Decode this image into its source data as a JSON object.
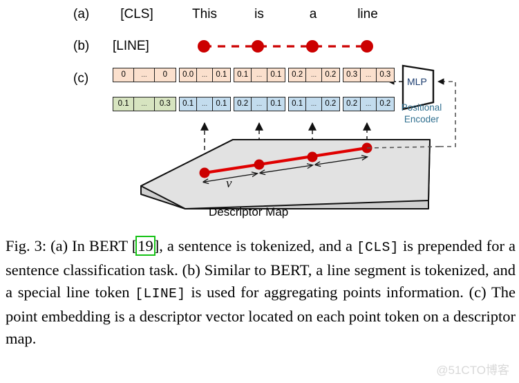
{
  "figure": {
    "rows": {
      "a": {
        "label": "(a)",
        "special_token": "[CLS]",
        "words": [
          "This",
          "is",
          "a",
          "line"
        ]
      },
      "b": {
        "label": "(b)",
        "special_token": "[LINE]",
        "point_count": 4
      },
      "c": {
        "label": "(c)"
      }
    },
    "embeddings": {
      "special": {
        "top": [
          "0",
          "...",
          "0"
        ],
        "bottom": [
          "0.1",
          "...",
          "0.3"
        ]
      },
      "tokens": [
        {
          "top": [
            "0.0",
            "...",
            "0.1"
          ],
          "bottom": [
            "0.1",
            "...",
            "0.1"
          ]
        },
        {
          "top": [
            "0.1",
            "...",
            "0.1"
          ],
          "bottom": [
            "0.2",
            "...",
            "0.1"
          ]
        },
        {
          "top": [
            "0.2",
            "...",
            "0.2"
          ],
          "bottom": [
            "0.1",
            "...",
            "0.2"
          ]
        },
        {
          "top": [
            "0.3",
            "...",
            "0.3"
          ],
          "bottom": [
            "0.2",
            "...",
            "0.2"
          ]
        }
      ]
    },
    "mlp_label": "MLP",
    "positional_encoder_label": "Positional\nEncoder",
    "positional_encoder_line1": "Positional",
    "positional_encoder_line2": "Encoder",
    "descriptor_map_label": "Descriptor Map",
    "vector_symbol": "v",
    "colors": {
      "point_red": "#cc0000",
      "line_red": "#e00000",
      "plane_fill": "#e2e2e2",
      "peach": "#fbe0cd",
      "green": "#d7e4c0",
      "blue": "#c3dcee",
      "mlp_text": "#1a3b6e",
      "positional_text": "#2f6f8f",
      "citation_highlight": "#16c216"
    }
  },
  "caption": {
    "prefix": "Fig. 3: (a) In BERT [",
    "citation": "19",
    "part1": "], a sentence is tokenized, and a ",
    "cls_token": "[CLS]",
    "part2": " is prepended for a sentence classification task. (b) Similar to BERT, a line segment is tokenized, and a special line token ",
    "line_token": "[LINE]",
    "part3": " is used for aggregating points information. (c) The point embedding is a descriptor vector located on each point token on a descriptor map."
  },
  "watermark": {
    "text": "@51CTO博客"
  }
}
